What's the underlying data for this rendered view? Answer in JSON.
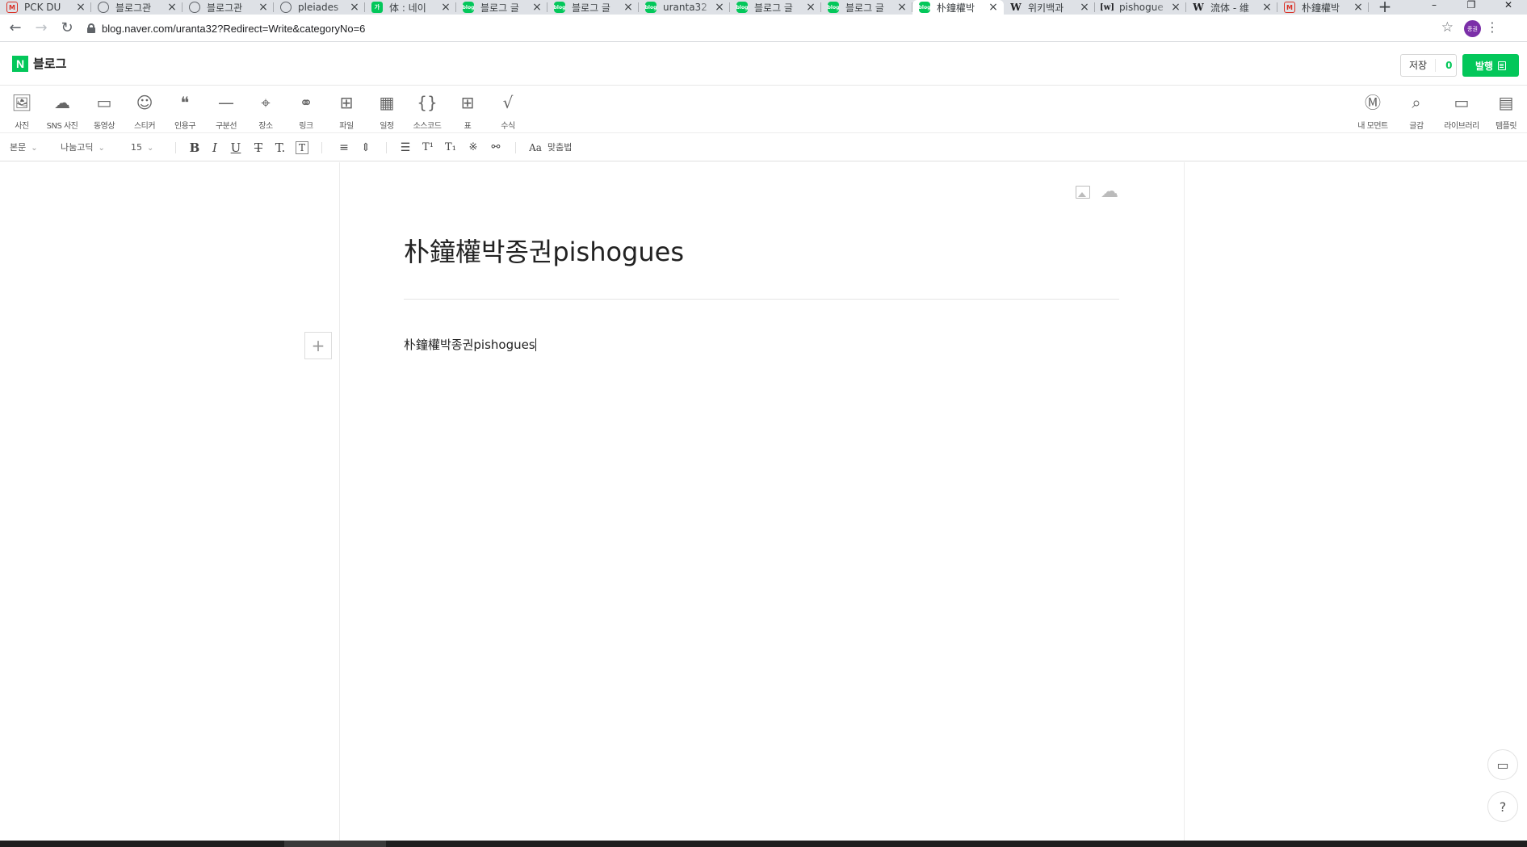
{
  "browser": {
    "tabs": [
      {
        "favicon": "gmail-icon",
        "title": "PCK DU"
      },
      {
        "favicon": "globe-icon",
        "title": "블로그관"
      },
      {
        "favicon": "globe-icon",
        "title": "블로그관"
      },
      {
        "favicon": "globe-icon",
        "title": "pleiades"
      },
      {
        "favicon": "naver-dictionary-icon",
        "title": "体 : 네이"
      },
      {
        "favicon": "naver-blog-icon",
        "title": "블로그 글"
      },
      {
        "favicon": "naver-blog-icon",
        "title": "블로그 글"
      },
      {
        "favicon": "naver-blog-icon",
        "title": "uranta32"
      },
      {
        "favicon": "naver-blog-icon",
        "title": "블로그 글"
      },
      {
        "favicon": "naver-blog-icon",
        "title": "블로그 글"
      },
      {
        "favicon": "naver-blog-icon",
        "title": "朴鐘權박",
        "active": true
      },
      {
        "favicon": "wikipedia-icon",
        "title": "위키백과"
      },
      {
        "favicon": "wiktionary-icon",
        "title": "pishogue"
      },
      {
        "favicon": "wikipedia-icon",
        "title": "流体 - 维"
      },
      {
        "favicon": "gmail-icon",
        "title": "朴鐘權박"
      }
    ],
    "url": "blog.naver.com/uranta32?Redirect=Write&categoryNo=6",
    "profile_initials": "종권"
  },
  "header": {
    "logo_letter": "N",
    "title": "블로그",
    "save_label": "저장",
    "save_count": "0",
    "publish_label": "발행"
  },
  "insert_toolbar": {
    "left": [
      {
        "icon": "photo-icon",
        "label": "사진"
      },
      {
        "icon": "cloud-upload-icon",
        "label": "SNS 사진"
      },
      {
        "icon": "video-icon",
        "label": "동영상"
      },
      {
        "icon": "sticker-icon",
        "label": "스티커"
      },
      {
        "icon": "quote-icon",
        "label": "인용구"
      },
      {
        "icon": "divider-icon",
        "label": "구분선"
      },
      {
        "icon": "map-pin-icon",
        "label": "장소"
      },
      {
        "icon": "link-icon",
        "label": "링크"
      },
      {
        "icon": "file-icon",
        "label": "파일"
      },
      {
        "icon": "calendar-icon",
        "label": "일정"
      },
      {
        "icon": "code-icon",
        "label": "소스코드"
      },
      {
        "icon": "table-icon",
        "label": "표"
      },
      {
        "icon": "formula-icon",
        "label": "수식"
      }
    ],
    "right": [
      {
        "icon": "moment-icon",
        "label": "내 모먼트"
      },
      {
        "icon": "book-search-icon",
        "label": "글감"
      },
      {
        "icon": "library-icon",
        "label": "라이브러리"
      },
      {
        "icon": "template-icon",
        "label": "템플릿"
      }
    ]
  },
  "format_bar": {
    "paragraph_style": "본문",
    "font_family": "나눔고딕",
    "font_size": "15",
    "spellcheck_label": "맞춤법"
  },
  "editor": {
    "title": "朴鐘權박종권pishogues",
    "body": "朴鐘權박종권pishogues"
  }
}
